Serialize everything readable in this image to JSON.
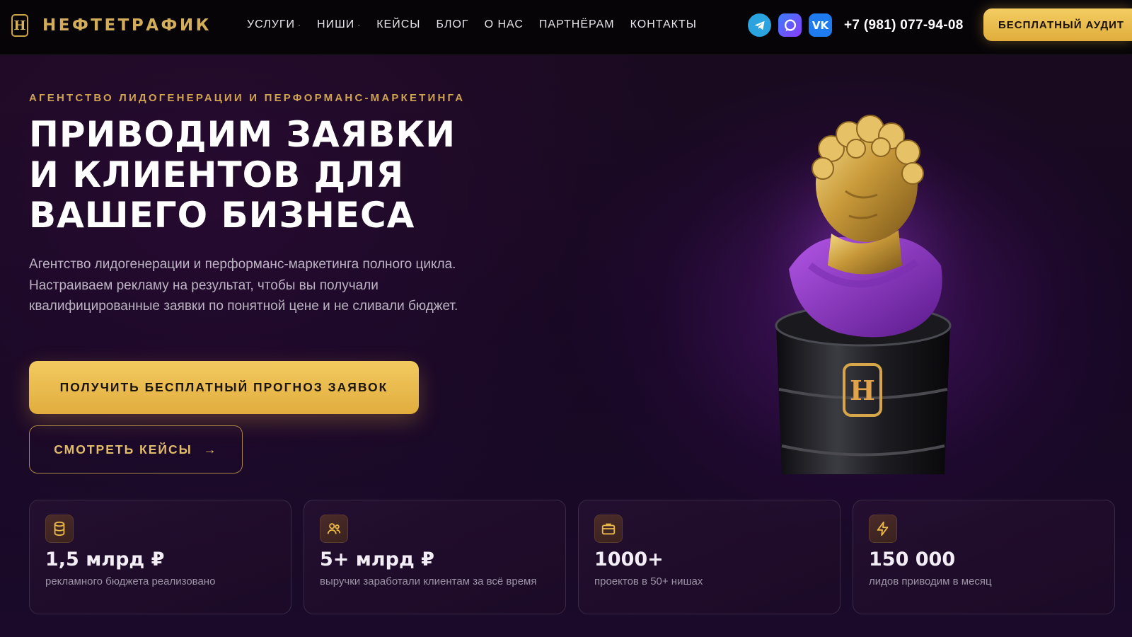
{
  "header": {
    "logo_mark": "Н",
    "logo_text": "НЕФТЕТРАФИК",
    "nav": [
      {
        "label": "УСЛУГИ",
        "has_dropdown": true
      },
      {
        "label": "НИШИ",
        "has_dropdown": true
      },
      {
        "label": "КЕЙСЫ",
        "has_dropdown": false
      },
      {
        "label": "БЛОГ",
        "has_dropdown": false
      },
      {
        "label": "О НАС",
        "has_dropdown": false
      },
      {
        "label": "ПАРТНЁРАМ",
        "has_dropdown": false
      },
      {
        "label": "КОНТАКТЫ",
        "has_dropdown": false
      }
    ],
    "dropdown_glyph": "·",
    "social": [
      "telegram-icon",
      "max-messenger-icon",
      "vk-icon"
    ],
    "vk_text": "VK",
    "phone": "+7 (981) 077-94-08",
    "audit_button": "БЕСПЛАТНЫЙ АУДИТ"
  },
  "hero": {
    "eyebrow": "АГЕНТСТВО ЛИДОГЕНЕРАЦИИ И ПЕРФОРМАНС-МАРКЕТИНГА",
    "title_lines": [
      "ПРИВОДИМ ЗАЯВКИ",
      "И КЛИЕНТОВ ДЛЯ",
      "ВАШЕГО БИЗНЕСА"
    ],
    "description": "Агентство лидогенерации и перформанс-маркетинга полного цикла. Настраиваем рекламу на результат, чтобы вы получали квалифицированные заявки по понятной цене и не сливали бюджет.",
    "cta_primary": "ПОЛУЧИТЬ БЕСПЛАТНЫЙ ПРОГНОЗ ЗАЯВОК",
    "cta_secondary": "СМОТРЕТЬ КЕЙСЫ",
    "cta_secondary_arrow": "→",
    "barrel_mark": "H"
  },
  "stats": [
    {
      "icon": "database-icon",
      "value": "1,5 млрд ₽",
      "label": "рекламного бюджета реализовано"
    },
    {
      "icon": "users-icon",
      "value": "5+ млрд ₽",
      "label": "выручки заработали клиентам за всё время"
    },
    {
      "icon": "briefcase-icon",
      "value": "1000+",
      "label": "проектов в 50+ нишах"
    },
    {
      "icon": "lightning-icon",
      "value": "150 000",
      "label": "лидов приводим в месяц"
    }
  ],
  "colors": {
    "gold": "#e8b84a",
    "background": "#160822",
    "purple": "#7a2aa8"
  }
}
